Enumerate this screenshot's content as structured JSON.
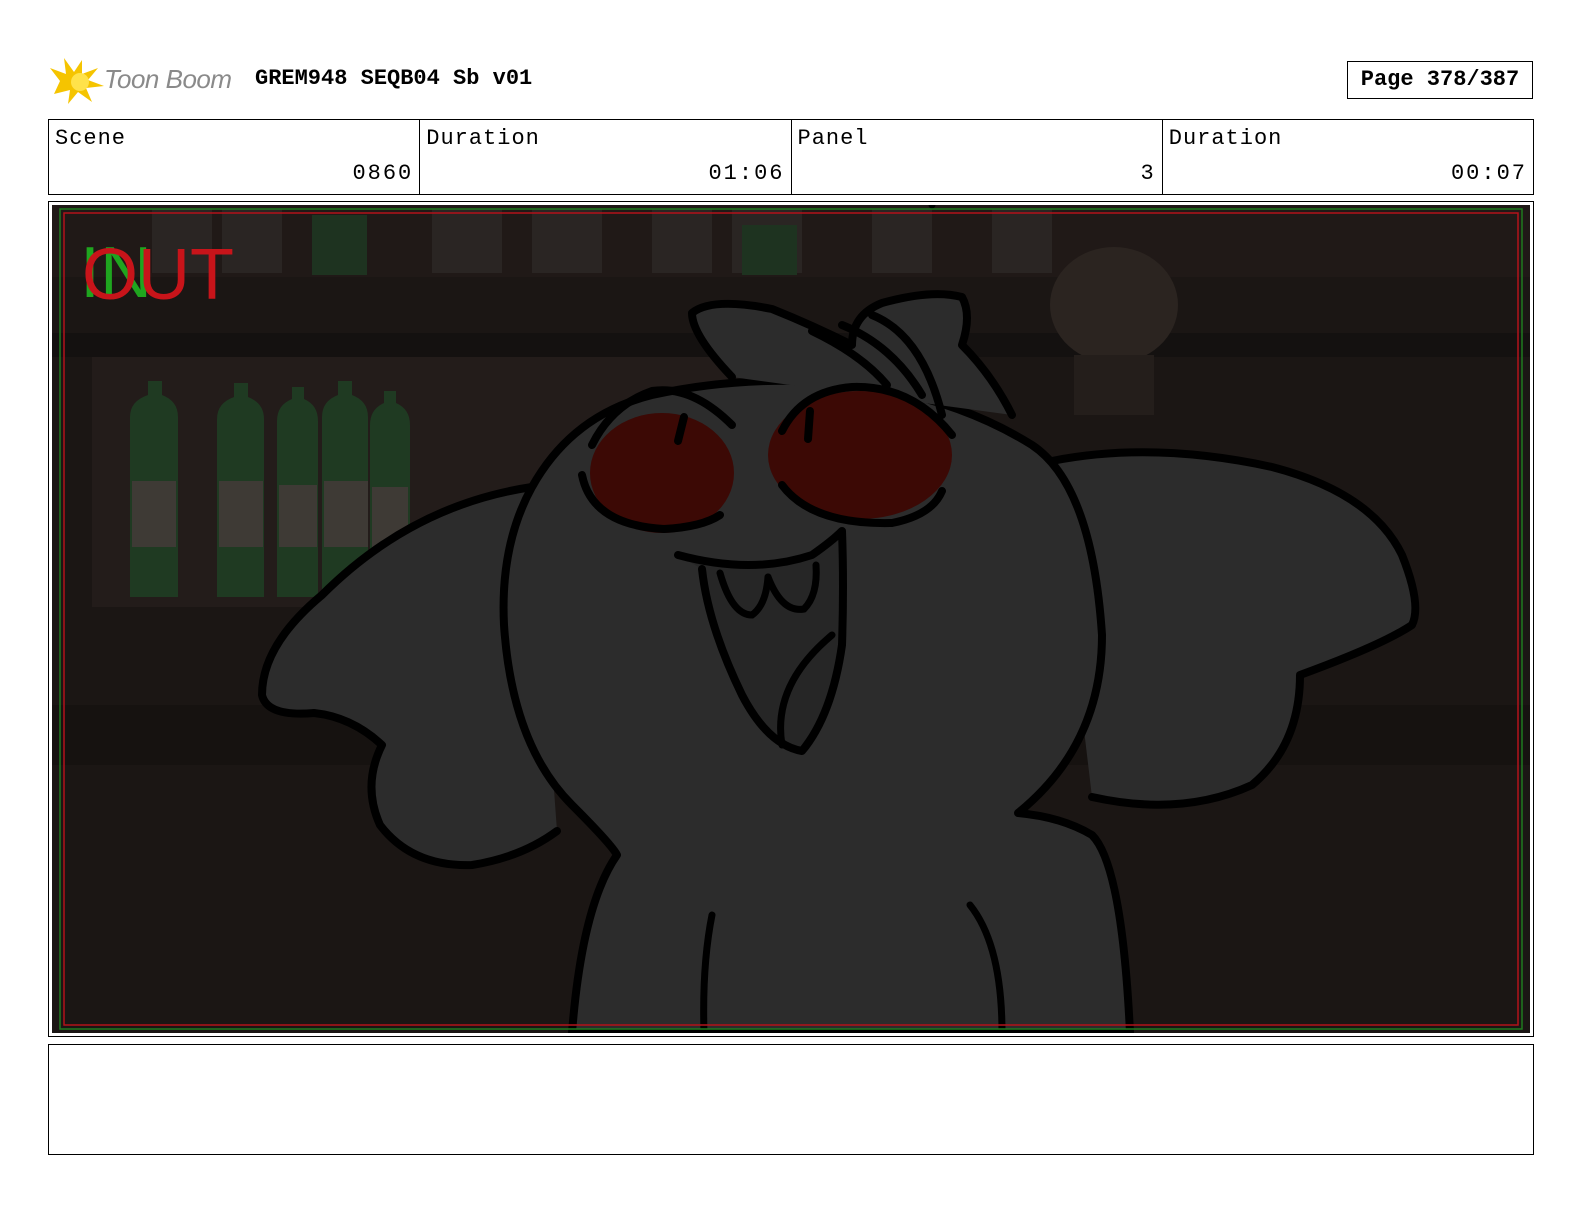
{
  "header": {
    "logo_text": "Toon Boom",
    "title": "GREM948 SEQB04 Sb v01",
    "page": "Page 378/387"
  },
  "info": {
    "scene_label": "Scene",
    "scene_value": "0860",
    "scene_duration_label": "Duration",
    "scene_duration_value": "01:06",
    "panel_label": "Panel",
    "panel_value": "3",
    "panel_duration_label": "Duration",
    "panel_duration_value": "00:07"
  },
  "frame_marks": {
    "in_label": "IN",
    "out_label": "OUT",
    "in_color": "#1fa51f",
    "out_color": "#c8141a"
  },
  "notes": {
    "text": ""
  }
}
